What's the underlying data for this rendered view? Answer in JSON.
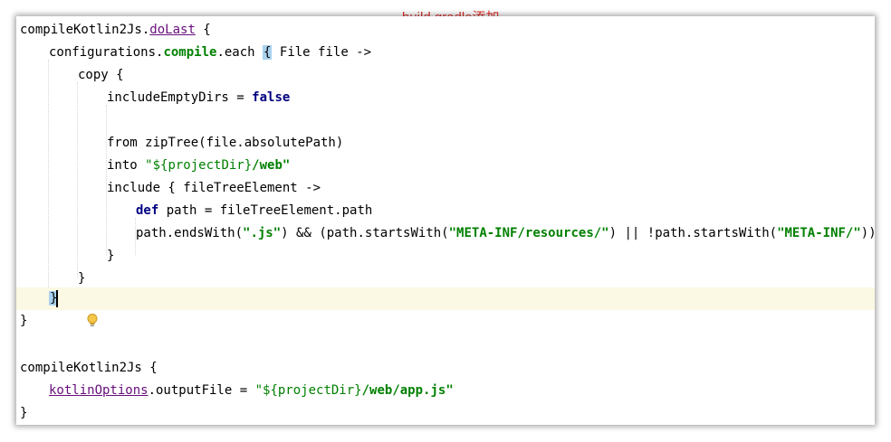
{
  "annotation": "build.gradle添加",
  "lines": [
    {
      "a": "compileKotlin2Js.",
      "b": "doLast",
      "c": " {"
    },
    {
      "a": "configurations.",
      "b": "compile",
      "c": ".each ",
      "d": "{",
      "e": " File file ->"
    },
    {
      "a": "copy {"
    },
    {
      "a": "includeEmptyDirs = ",
      "b": "false"
    },
    {
      "a": "from zipTree(file.absolutePath)"
    },
    {
      "a": "into ",
      "b": "\"${projectDir}",
      "c": "/web\""
    },
    {
      "a": "include { fileTreeElement ->"
    },
    {
      "a": "def",
      "b": " path = fileTreeElement.path"
    },
    {
      "a": "path.endsWith(",
      "b": "\".js\"",
      "c": ") && (path.startsWith(",
      "d": "\"META-INF/resources/\"",
      "e": ") || !path.startsWith(",
      "f": "\"META-INF/\"",
      "g": "))"
    },
    {
      "a": "}"
    },
    {
      "a": "}"
    },
    {
      "a": "}"
    },
    {
      "a": "}"
    },
    {
      "a": "compileKotlin2Js {"
    },
    {
      "a": "kotlinOptions",
      "b": ".outputFile = ",
      "c": "\"${projectDir}",
      "d": "/web/app.js\""
    },
    {
      "a": "}"
    }
  ],
  "icons": {
    "intention": "lightbulb-icon"
  },
  "colors": {
    "keyword": "#000080",
    "member": "#660e7a",
    "string": "#008000",
    "annotation": "#e0302b",
    "current_line": "#fbf8e3",
    "brace_highlight": "#a9d1ee"
  }
}
